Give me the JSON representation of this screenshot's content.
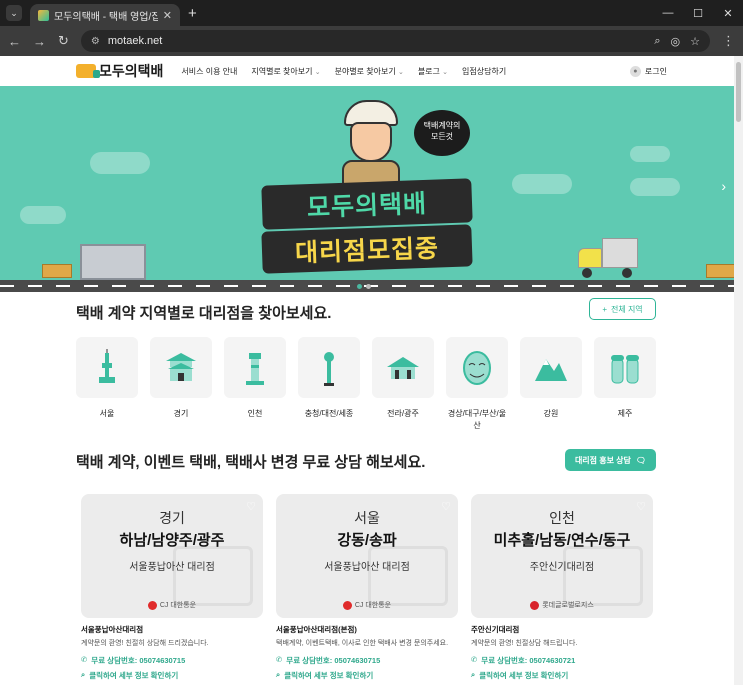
{
  "browser": {
    "tab_title": "모두의택배 - 택배 영업/집배점",
    "url": "motaek.net"
  },
  "nav": {
    "logo": "모두의택배",
    "items": [
      {
        "label": "서비스 이용 안내",
        "caret": false
      },
      {
        "label": "지역별로 찾아보기",
        "caret": true
      },
      {
        "label": "분야별로 찾아보기",
        "caret": true
      },
      {
        "label": "블로그",
        "caret": true
      },
      {
        "label": "입점상담하기",
        "caret": false
      }
    ],
    "login": "로그인"
  },
  "hero": {
    "bubble_line1": "택배계약의",
    "bubble_line2": "모든것",
    "banner_line1": "모두의택배",
    "banner_line2": "대리점모집중"
  },
  "section_regions": {
    "title": "택배 계약 지역별로 대리점을 찾아보세요.",
    "all_button": "전체 지역",
    "regions": [
      "서울",
      "경기",
      "인천",
      "충청/대전/세종",
      "전라/광주",
      "경상/대구/부산/울산",
      "강원",
      "제주"
    ]
  },
  "section_consult": {
    "title": "택배 계약, 이벤트 택배, 택배사 변경 무료 상담 해보세요.",
    "consult_button": "대리점 홍보 상담",
    "cards": [
      {
        "region": "경기",
        "area": "하남/남양주/광주",
        "office": "서울풍납아산 대리점",
        "carrier": "CJ 대한통운",
        "carrier_color": "#e02b2b",
        "name": "서울풍납아산대리점",
        "desc": "계약문의 환영! 친절히 상담해 드리겠습니다.",
        "phone": "무료 상담번호: 05074630715",
        "detail": "클릭하여 세부 정보 확인하기"
      },
      {
        "region": "서울",
        "area": "강동/송파",
        "office": "서울풍납아산 대리점",
        "carrier": "CJ 대한통운",
        "carrier_color": "#e02b2b",
        "name": "서울풍납아산대리점(본점)",
        "desc": "택배계약, 이벤트택배, 이사로 인한 택배사 변경 문의주세요.",
        "phone": "무료 상담번호: 05074630715",
        "detail": "클릭하여 세부 정보 확인하기"
      },
      {
        "region": "인천",
        "area": "미추홀/남동/연수/동구",
        "office": "주안신기대리점",
        "carrier": "롯데글로벌로지스",
        "carrier_color": "#d8242c",
        "name": "주안신기대리점",
        "desc": "계약문의 환영! 친절상담 해드립니다.",
        "phone": "무료 상담번호: 05074630721",
        "detail": "클릭하여 세부 정보 확인하기"
      }
    ]
  },
  "colors": {
    "accent": "#3bbc9f",
    "hero_bg": "#5fcab2"
  }
}
